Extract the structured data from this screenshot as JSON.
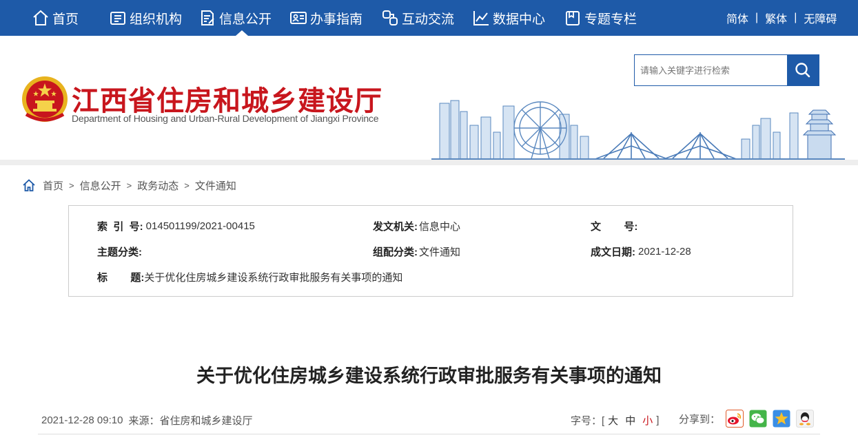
{
  "nav": {
    "items": [
      {
        "label": "首页",
        "icon": "home-icon"
      },
      {
        "label": "组织机构",
        "icon": "org-chart-icon"
      },
      {
        "label": "信息公开",
        "icon": "document-edit-icon"
      },
      {
        "label": "办事指南",
        "icon": "id-card-icon"
      },
      {
        "label": "互动交流",
        "icon": "chat-link-icon"
      },
      {
        "label": "数据中心",
        "icon": "line-chart-icon"
      },
      {
        "label": "专题专栏",
        "icon": "folder-icon"
      }
    ],
    "active": "信息公开",
    "lang": {
      "simplified": "简体",
      "traditional": "繁体",
      "accessible": "无障碍",
      "separator": "|"
    }
  },
  "header": {
    "title": "江西省住房和城乡建设厅",
    "subtitle": "Department of Housing and Urban-Rural Development of Jiangxi Province",
    "search_placeholder": "请输入关键字进行检索"
  },
  "breadcrumb": {
    "items": [
      "首页",
      "信息公开",
      "政务动态",
      "文件通知"
    ],
    "separator": ">"
  },
  "info": {
    "index_label": "索  引  号:",
    "index_value": "014501199/2021-00415",
    "issuer_label": "发文机关:",
    "issuer_value": "信息中心",
    "docno_label": "文        号:",
    "docno_value": "",
    "topic_label": "主题分类:",
    "topic_value": "",
    "category_label": "组配分类:",
    "category_value": "文件通知",
    "date_label": "成文日期:",
    "date_value": "2021-12-28",
    "title_label": "标        题:",
    "title_value": "关于优化住房城乡建设系统行政审批服务有关事项的通知"
  },
  "article": {
    "title": "关于优化住房城乡建设系统行政审批服务有关事项的通知",
    "datetime": "2021-12-28 09:10",
    "source": "来源：省住房和城乡建设厅",
    "font_size_label": "字号：[",
    "font_large": "大",
    "font_medium": "中",
    "font_small": "小",
    "font_close": "]",
    "font_active": "小",
    "share_label": "分享到：",
    "share_icons": [
      "weibo-icon",
      "wechat-icon",
      "qzone-icon",
      "qq-icon"
    ]
  },
  "colors": {
    "brand_blue": "#1e5aa8",
    "brand_red": "#c8161d"
  }
}
